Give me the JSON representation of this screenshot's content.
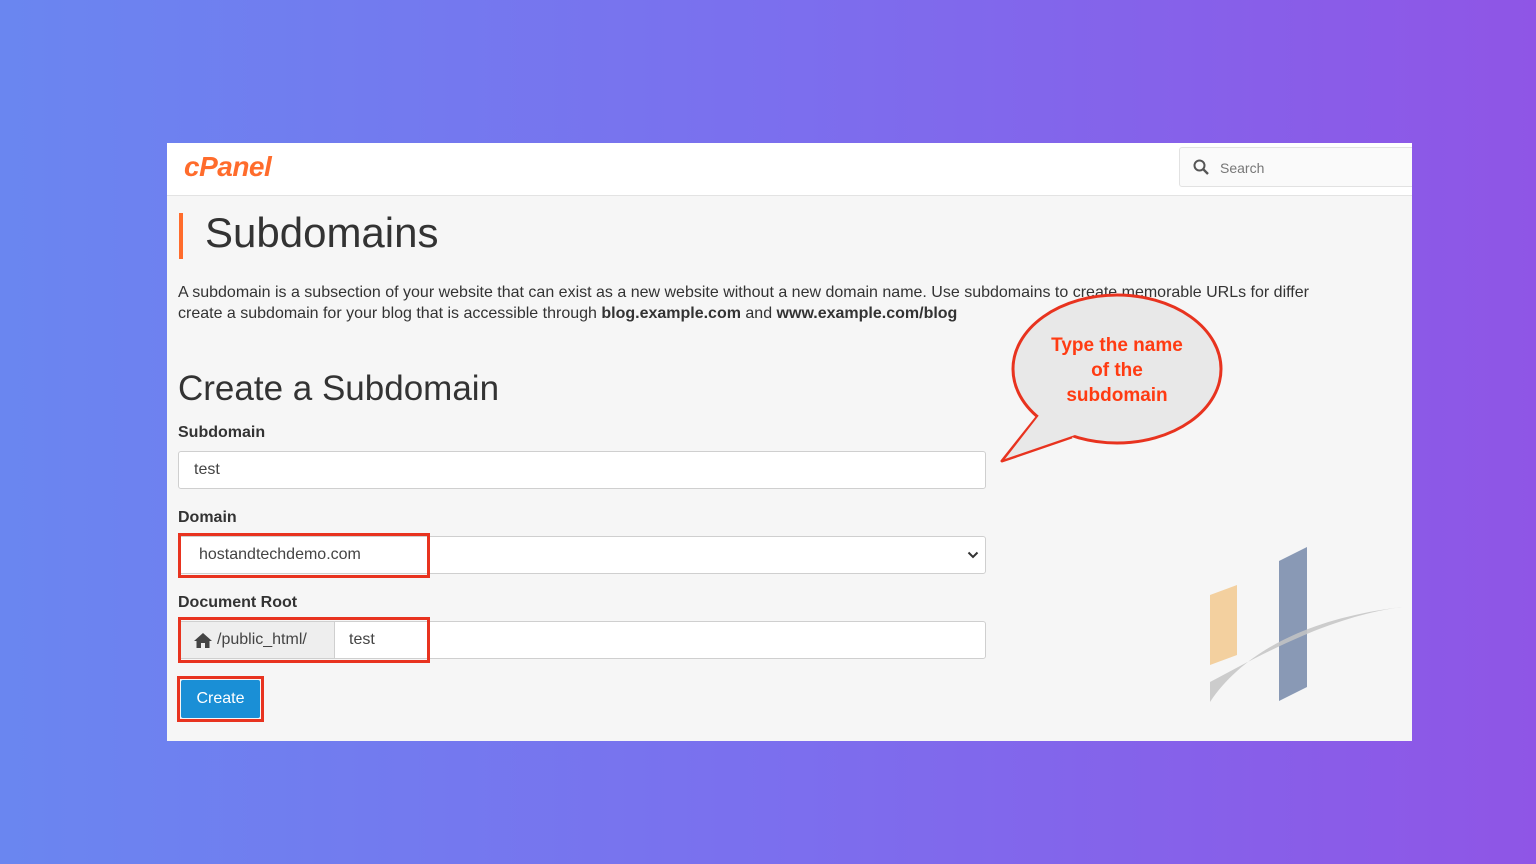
{
  "app": {
    "logo": "cPanel",
    "search_placeholder": "Search"
  },
  "page": {
    "title": "Subdomains",
    "description_line1": "A subdomain is a subsection of your website that can exist as a new website without a new domain name. Use subdomains to create memorable URLs for differ",
    "description_line2_a": "create a subdomain for your blog that is accessible through ",
    "description_line2_b": "blog.example.com",
    "description_line2_c": " and ",
    "description_line2_d": "www.example.com/blog"
  },
  "form": {
    "heading": "Create a Subdomain",
    "subdomain_label": "Subdomain",
    "subdomain_value": "test",
    "domain_label": "Domain",
    "domain_value": "hostandtechdemo.com",
    "docroot_label": "Document Root",
    "docroot_prefix": "/public_html/",
    "docroot_value": "test",
    "create_button": "Create"
  },
  "callout": {
    "line1": "Type the name",
    "line2": "of the",
    "line3": "subdomain"
  },
  "colors": {
    "accent": "#ff6c2c",
    "highlight": "#e8331f",
    "button": "#1a8fd6",
    "callout_text": "#ff3b12"
  }
}
